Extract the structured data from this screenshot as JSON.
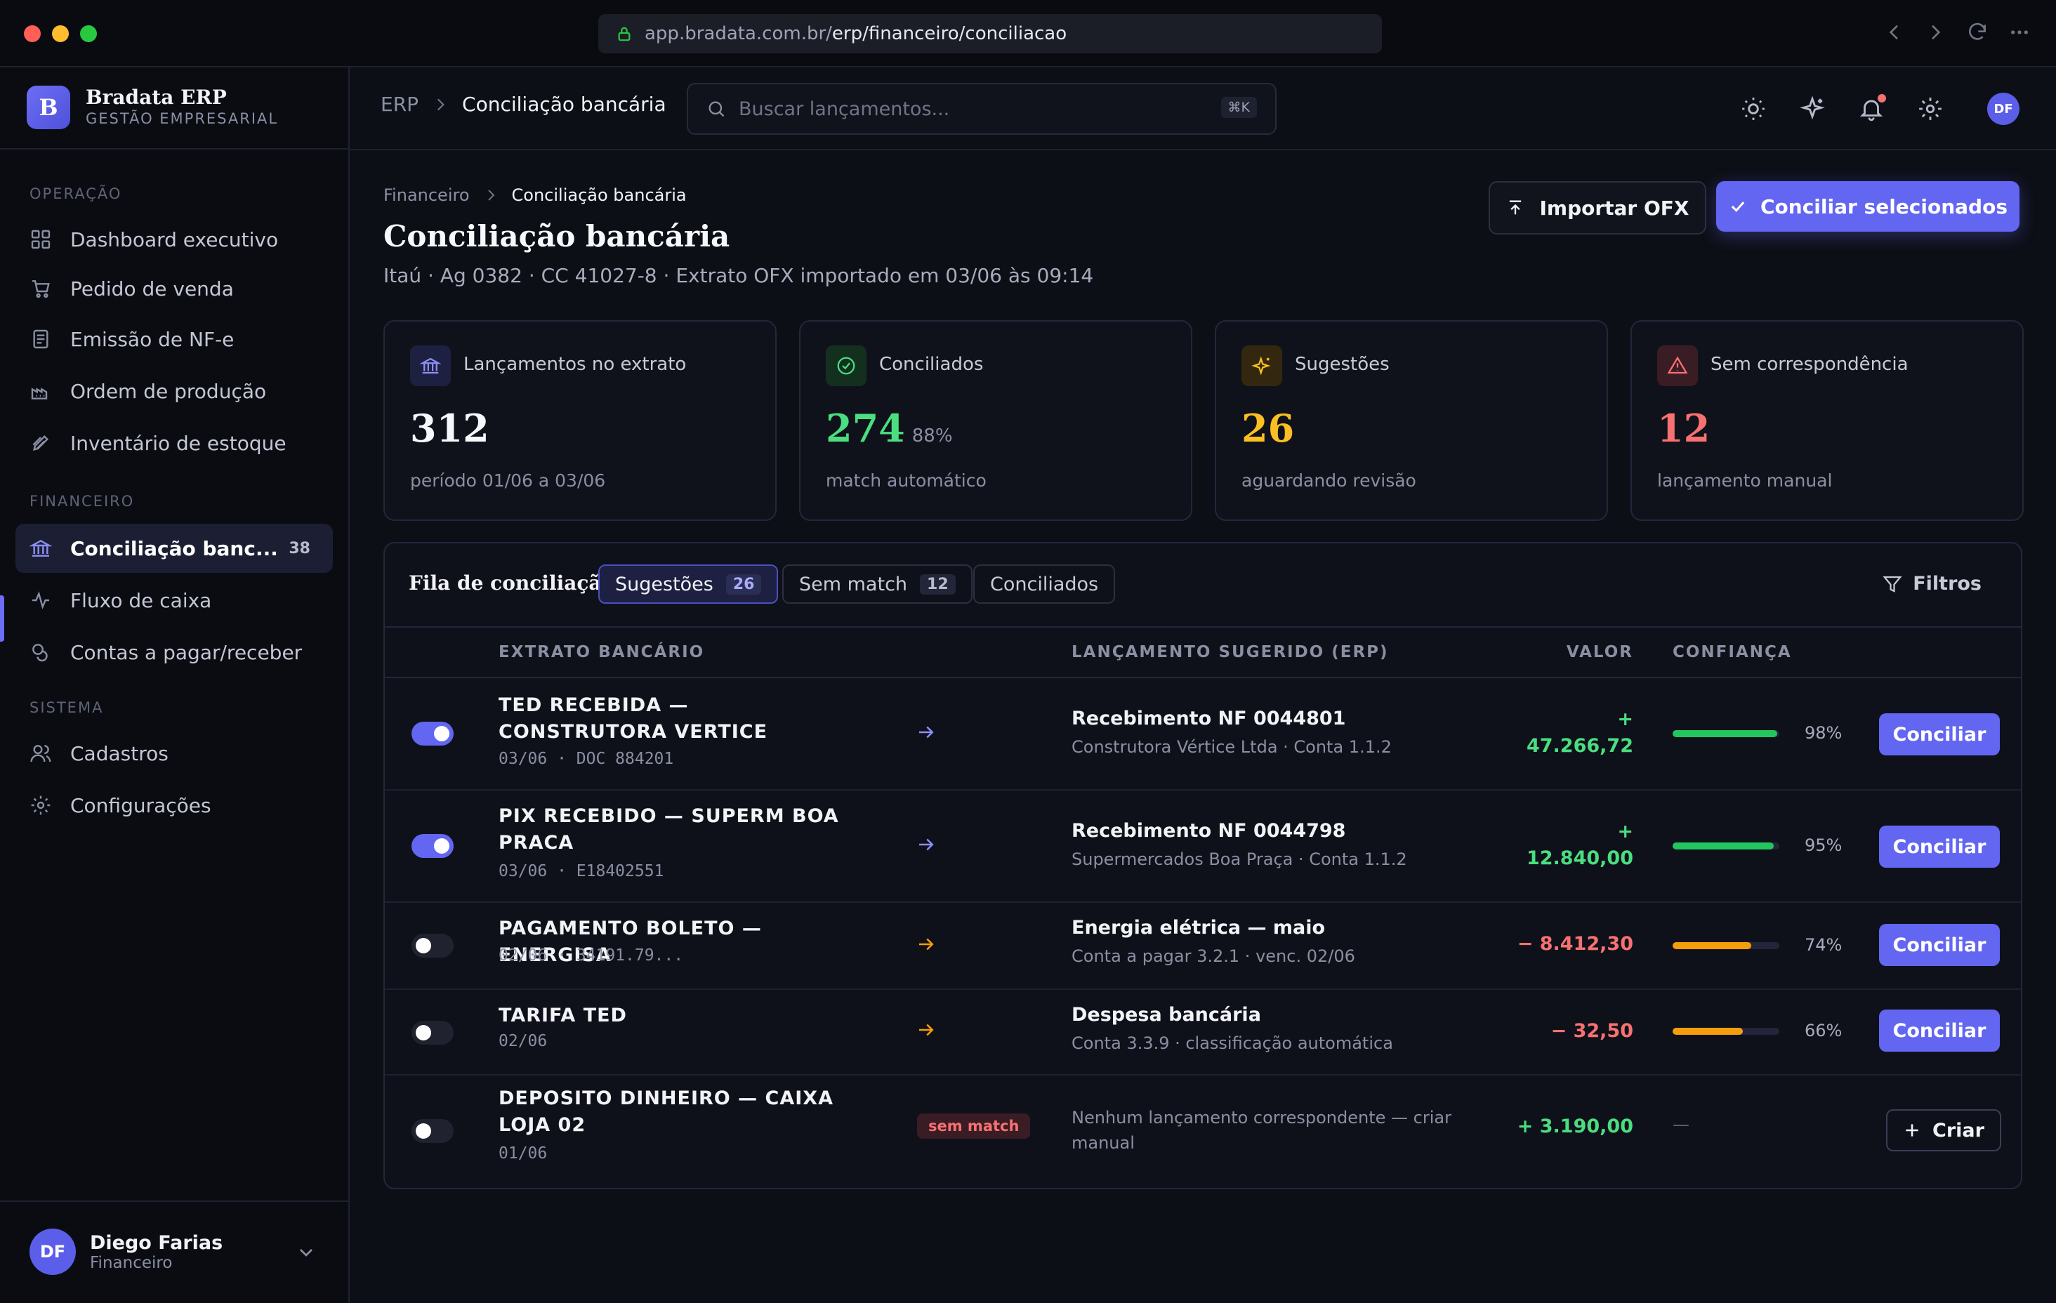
{
  "browser": {
    "url_host": "app.bradata.com.br/",
    "url_path": "erp/financeiro/conciliacao"
  },
  "sidebar": {
    "brand_logo": "B",
    "brand_name": "Bradata ERP",
    "brand_sub": "GESTÃO EMPRESARIAL",
    "sections": [
      {
        "title": "OPERAÇÃO"
      },
      {
        "title": "FINANCEIRO"
      },
      {
        "title": "SISTEMA"
      }
    ],
    "items": [
      {
        "label": "Dashboard executivo",
        "icon": "grid-icon"
      },
      {
        "label": "Pedido de venda",
        "icon": "cart-icon"
      },
      {
        "label": "Emissão de NF-e",
        "icon": "document-icon"
      },
      {
        "label": "Ordem de produção",
        "icon": "factory-icon"
      },
      {
        "label": "Inventário de estoque",
        "icon": "box-icon"
      },
      {
        "label": "Conciliação banc...",
        "icon": "bank-icon",
        "badge": "38",
        "active": true
      },
      {
        "label": "Fluxo de caixa",
        "icon": "activity-icon"
      },
      {
        "label": "Contas a pagar/receber",
        "icon": "coins-icon"
      },
      {
        "label": "Cadastros",
        "icon": "users-icon"
      },
      {
        "label": "Configurações",
        "icon": "gear-icon"
      }
    ],
    "user": {
      "initials": "DF",
      "name": "Diego Farias",
      "role": "Financeiro"
    }
  },
  "topbar": {
    "crumb_root": "ERP",
    "crumb_current": "Conciliação bancária",
    "search_placeholder": "Buscar lançamentos...",
    "search_shortcut": "⌘K",
    "avatar": "DF"
  },
  "page": {
    "crumb_parent": "Financeiro",
    "crumb_current": "Conciliação bancária",
    "title": "Conciliação bancária",
    "subtitle": "Itaú · Ag 0382 · CC 41027-8 · Extrato OFX importado em 03/06 às 09:14",
    "import_label": "Importar OFX",
    "primary_label": "Conciliar selecionados"
  },
  "cards": [
    {
      "label": "Lançamentos no extrato",
      "value": "312",
      "pct": "",
      "foot": "período 01/06 a 03/06",
      "color": "#f7f8fb",
      "icon": "bank-icon"
    },
    {
      "label": "Conciliados",
      "value": "274",
      "pct": "88%",
      "foot": "match automático",
      "color": "#4ade80",
      "icon": "check-circle-icon"
    },
    {
      "label": "Sugestões",
      "value": "26",
      "pct": "",
      "foot": "aguardando revisão",
      "color": "#fbbf24",
      "icon": "sparkle-icon"
    },
    {
      "label": "Sem correspondência",
      "value": "12",
      "pct": "",
      "foot": "lançamento manual",
      "color": "#f87171",
      "icon": "warning-icon"
    }
  ],
  "queue": {
    "title": "Fila de conciliação",
    "tabs": [
      {
        "label": "Sugestões",
        "count": "26"
      },
      {
        "label": "Sem match",
        "count": "12"
      },
      {
        "label": "Conciliados",
        "count": ""
      }
    ],
    "filters_label": "Filtros",
    "columns": {
      "extrato": "EXTRATO BANCÁRIO",
      "lancamento": "LANÇAMENTO SUGERIDO (ERP)",
      "valor": "VALOR",
      "confianca": "CONFIANÇA"
    },
    "rows": [
      {
        "selected": true,
        "title": "TED RECEBIDA — CONSTRUTORA VERTICE",
        "meta": "03/06 · DOC 884201",
        "sug_title": "Recebimento NF 0044801",
        "sug_sub": "Construtora Vértice Ltda · Conta 1.1.2",
        "valor_sign": "+",
        "valor": "47.266,72",
        "confidence": 98,
        "confidence_label": "98%",
        "action": "Conciliar"
      },
      {
        "selected": true,
        "title": "PIX RECEBIDO — SUPERM BOA PRACA",
        "meta": "03/06 · E18402551",
        "sug_title": "Recebimento NF 0044798",
        "sug_sub": "Supermercados Boa Praça · Conta 1.1.2",
        "valor_sign": "+",
        "valor": "12.840,00",
        "confidence": 95,
        "confidence_label": "95%",
        "action": "Conciliar"
      },
      {
        "selected": false,
        "title": "PAGAMENTO BOLETO — ENERGISA",
        "meta": "02/06 · 34191.79...",
        "sug_title": "Energia elétrica — maio",
        "sug_sub": "Conta a pagar 3.2.1 · venc. 02/06",
        "valor": "− 8.412,30",
        "confidence": 74,
        "confidence_label": "74%",
        "action": "Conciliar"
      },
      {
        "selected": false,
        "title": "TARIFA TED",
        "meta": "02/06",
        "sug_title": "Despesa bancária",
        "sug_sub": "Conta 3.3.9 · classificação automática",
        "valor": "− 32,50",
        "confidence": 66,
        "confidence_label": "66%",
        "action": "Conciliar"
      },
      {
        "selected": false,
        "title": "DEPOSITO DINHEIRO — CAIXA LOJA 02",
        "meta": "01/06",
        "badge": "sem match",
        "sug_text": "Nenhum lançamento correspondente — criar manual",
        "valor": "+ 3.190,00",
        "confidence_label": "—",
        "action": "Criar"
      }
    ]
  },
  "colors": {
    "accent": "#6366f1",
    "positive": "#4ade80",
    "negative": "#f87171",
    "warning": "#f59e0b",
    "success_bar": "#22c55e"
  }
}
